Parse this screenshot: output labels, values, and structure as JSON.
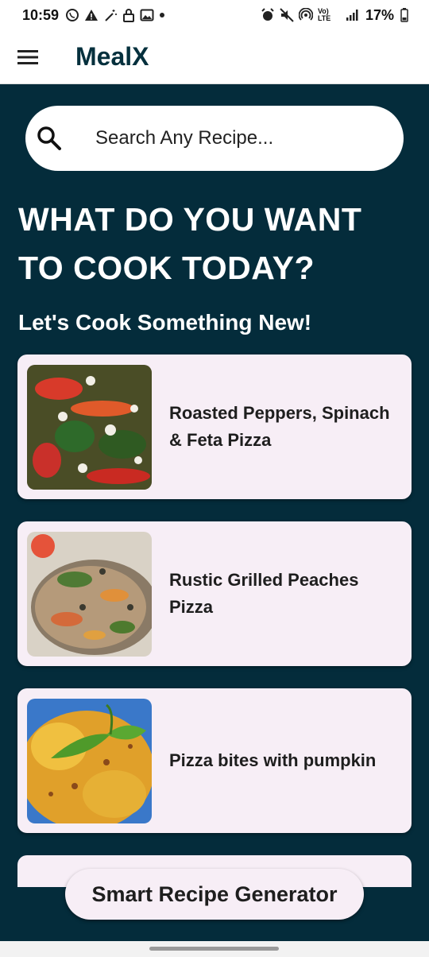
{
  "status_bar": {
    "time": "10:59",
    "battery": "17%",
    "network_label": "Vo) LTE",
    "left_icons": [
      "whatsapp-icon",
      "warning-icon",
      "magic-wand-icon",
      "lock-icon",
      "image-icon",
      "dot-icon"
    ],
    "right_icons": [
      "alarm-icon",
      "mute-icon",
      "hotspot-icon",
      "lte-icon",
      "signal-icon",
      "battery-icon"
    ]
  },
  "app_bar": {
    "title": "MealX",
    "menu_icon": "hamburger-menu-icon"
  },
  "search": {
    "placeholder": "Search Any Recipe...",
    "value": ""
  },
  "headline": "WHAT DO YOU WANT TO COOK TODAY?",
  "subheadline": "Let's Cook Something New!",
  "recipes": [
    {
      "title": "Roasted Peppers, Spinach & Feta Pizza"
    },
    {
      "title": "Rustic Grilled Peaches Pizza"
    },
    {
      "title": "Pizza bites with pumpkin"
    }
  ],
  "fab": {
    "label": "Smart Recipe Generator"
  },
  "colors": {
    "background": "#042c3b",
    "card": "#f7eef6",
    "title": "#05303d"
  }
}
